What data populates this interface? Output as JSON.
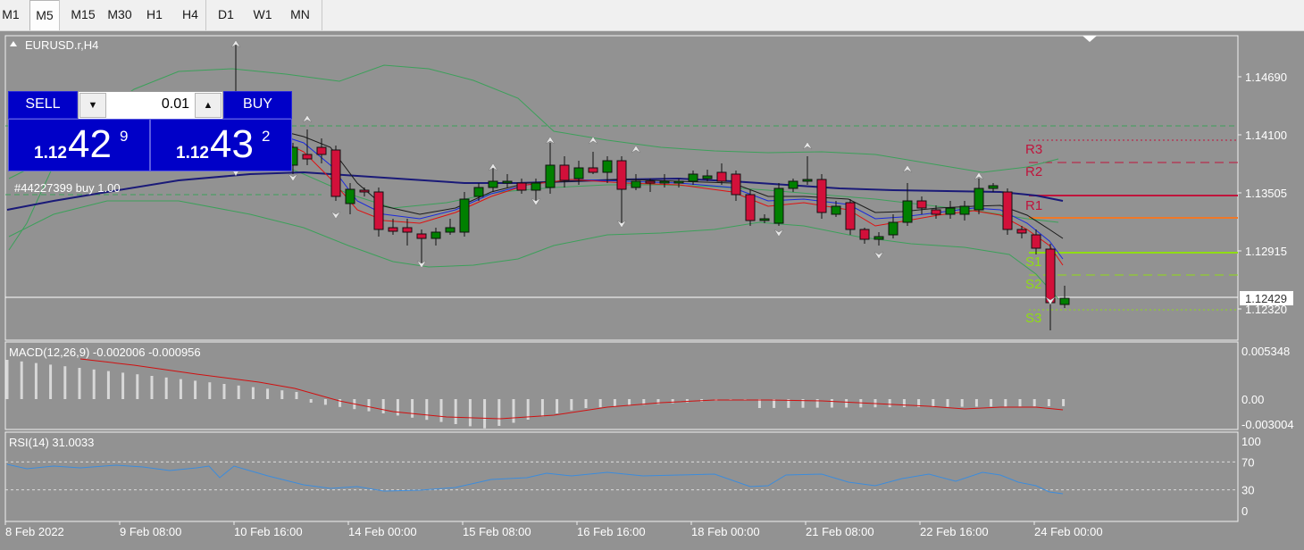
{
  "toolbar": {
    "timeframes": [
      {
        "label": "M1",
        "active": false
      },
      {
        "label": "M5",
        "active": true
      },
      {
        "label": "M15",
        "active": false
      },
      {
        "label": "M30",
        "active": false
      },
      {
        "label": "H1",
        "active": false
      },
      {
        "label": "H4",
        "active": false
      },
      {
        "label": "D1",
        "active": false
      },
      {
        "label": "W1",
        "active": false
      },
      {
        "label": "MN",
        "active": false
      }
    ]
  },
  "chart": {
    "symbol_label": "EURUSD.r,H4",
    "order_label": "#44227399 buy 1.00",
    "current_price_tag": "1.12429",
    "pivot_labels": {
      "r3": "R3",
      "r2": "R2",
      "r1": "R1",
      "s1": "S1",
      "s2": "S2",
      "s3": "S3"
    },
    "price_axis": [
      "1.14690",
      "1.14100",
      "1.13505",
      "1.12915",
      "1.12320"
    ],
    "time_axis": [
      "8 Feb 2022",
      "9 Feb 08:00",
      "10 Feb 16:00",
      "14 Feb 00:00",
      "15 Feb 08:00",
      "16 Feb 16:00",
      "18 Feb 00:00",
      "21 Feb 08:00",
      "22 Feb 16:00",
      "24 Feb 00:00"
    ],
    "colors": {
      "background": "#929292",
      "bull": "#008000",
      "bear": "#d2103a",
      "bollinger": "#3ca05a",
      "ma_slow": "#1a1a78",
      "ma_red": "#e01010",
      "ma_blue": "#1a2adc",
      "ma_black": "#1a1a1a",
      "r_levels": "#c0143c",
      "s_levels": "#90dc14",
      "pivot": "#f07828",
      "macd_signal": "#d01010",
      "macd_hist": "#d8d8d8",
      "rsi_line": "#3c8cdc"
    }
  },
  "trade_panel": {
    "sell_label": "SELL",
    "buy_label": "BUY",
    "lot_value": "0.01",
    "down_arrow": "▼",
    "up_arrow": "▲",
    "bid_prefix": "1.12",
    "bid_main": "42",
    "bid_sup": "9",
    "ask_prefix": "1.12",
    "ask_main": "43",
    "ask_sup": "2"
  },
  "macd": {
    "label": "MACD(12,26,9) -0.002006 -0.000956",
    "axis": [
      "0.005348",
      "0.00",
      "-0.003004"
    ]
  },
  "rsi": {
    "label": "RSI(14) 31.0033",
    "axis": [
      "100",
      "70",
      "30",
      "0"
    ]
  }
}
